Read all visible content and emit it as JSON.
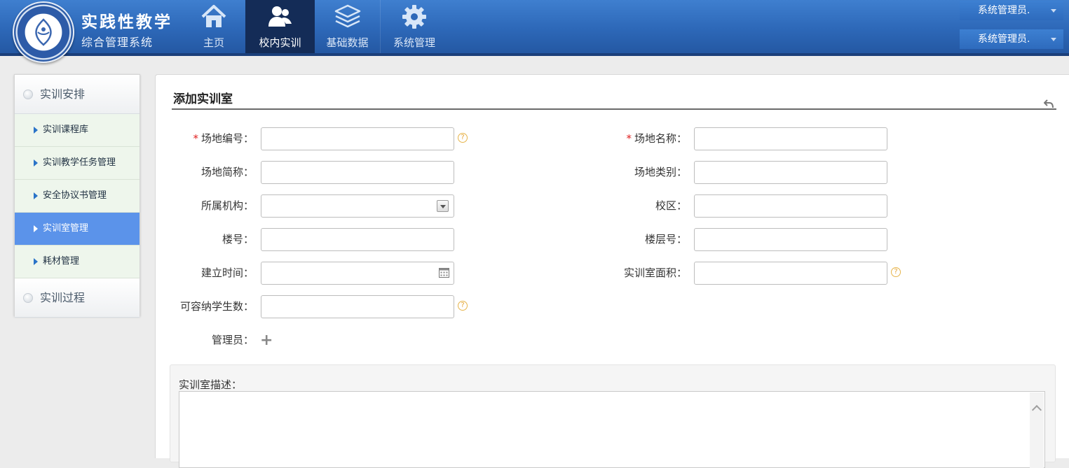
{
  "header": {
    "title": "实践性教学",
    "subtitle": "综合管理系统",
    "nav": [
      {
        "label": "主页",
        "icon": "home-icon"
      },
      {
        "label": "校内实训",
        "icon": "users-icon",
        "active": true
      },
      {
        "label": "基础数据",
        "icon": "layers-icon"
      },
      {
        "label": "系统管理",
        "icon": "gear-icon"
      }
    ],
    "user_menus": [
      "系统管理员.",
      "系统管理员."
    ]
  },
  "sidebar": {
    "groups": [
      {
        "label": "实训安排",
        "items": [
          {
            "label": "实训课程库"
          },
          {
            "label": "实训教学任务管理"
          },
          {
            "label": "安全协议书管理"
          },
          {
            "label": "实训室管理",
            "active": true
          },
          {
            "label": "耗材管理"
          }
        ]
      },
      {
        "label": "实训过程"
      }
    ]
  },
  "form": {
    "title": "添加实训室",
    "fields": {
      "code": {
        "label": "场地编号：",
        "value": "",
        "required": true
      },
      "name": {
        "label": "场地名称：",
        "value": "",
        "required": true
      },
      "short_name": {
        "label": "场地简称：",
        "value": ""
      },
      "category": {
        "label": "场地类别：",
        "value": ""
      },
      "org": {
        "label": "所属机构：",
        "value": ""
      },
      "campus": {
        "label": "校区：",
        "value": ""
      },
      "building": {
        "label": "楼号：",
        "value": ""
      },
      "floor": {
        "label": "楼层号：",
        "value": ""
      },
      "built_time": {
        "label": "建立时间：",
        "value": ""
      },
      "area": {
        "label": "实训室面积：",
        "value": ""
      },
      "capacity": {
        "label": "可容纳学生数：",
        "value": ""
      },
      "admin": {
        "label": "管理员："
      }
    },
    "required_mark": "*",
    "help_mark": "?",
    "plus_mark": "+",
    "description": {
      "label": "实训室描述：",
      "value": ""
    }
  },
  "colors": {
    "header_blue": "#2d68b8",
    "nav_active": "#142c57",
    "sidebar_active": "#5b93ea",
    "required_red": "#e02020"
  }
}
